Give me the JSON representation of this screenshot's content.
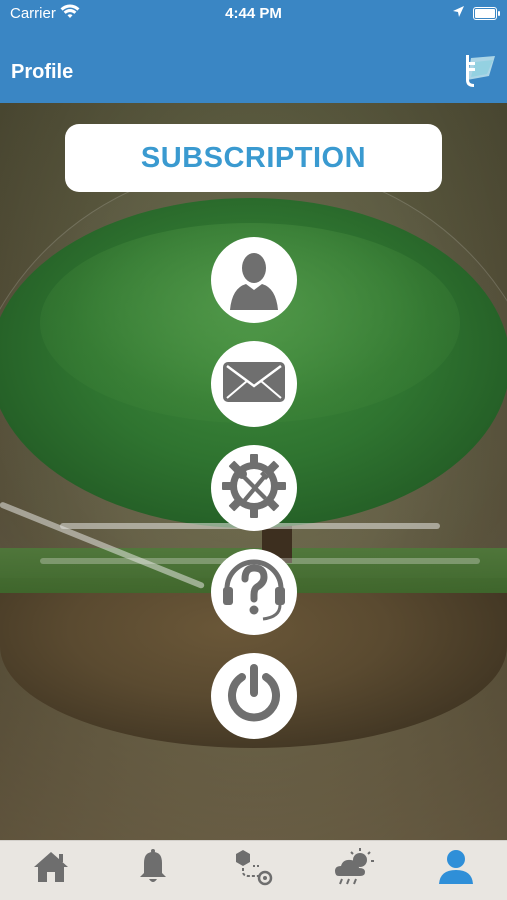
{
  "status_bar": {
    "carrier": "Carrier",
    "time": "4:44 PM",
    "wifi_icon": "wifi-icon",
    "location_icon": "location-arrow-icon",
    "battery_icon": "battery-icon"
  },
  "navbar": {
    "title": "Profile",
    "logo_icon": "app-logo-icon",
    "background_color": "#3a86c4"
  },
  "main": {
    "subscription_label": "SUBSCRIPTION",
    "subscription_color": "#3a9ad0",
    "menu_buttons": [
      {
        "icon": "user-icon"
      },
      {
        "icon": "mail-icon"
      },
      {
        "icon": "settings-tools-icon"
      },
      {
        "icon": "help-icon"
      },
      {
        "icon": "power-icon"
      }
    ]
  },
  "tab_bar": {
    "tabs": [
      {
        "icon": "home-icon",
        "active": false
      },
      {
        "icon": "bell-icon",
        "active": false
      },
      {
        "icon": "route-icon",
        "active": false
      },
      {
        "icon": "weather-icon",
        "active": false
      },
      {
        "icon": "profile-icon",
        "active": true
      }
    ],
    "active_color": "#2f8fd8",
    "inactive_color": "#6e6e6e"
  }
}
